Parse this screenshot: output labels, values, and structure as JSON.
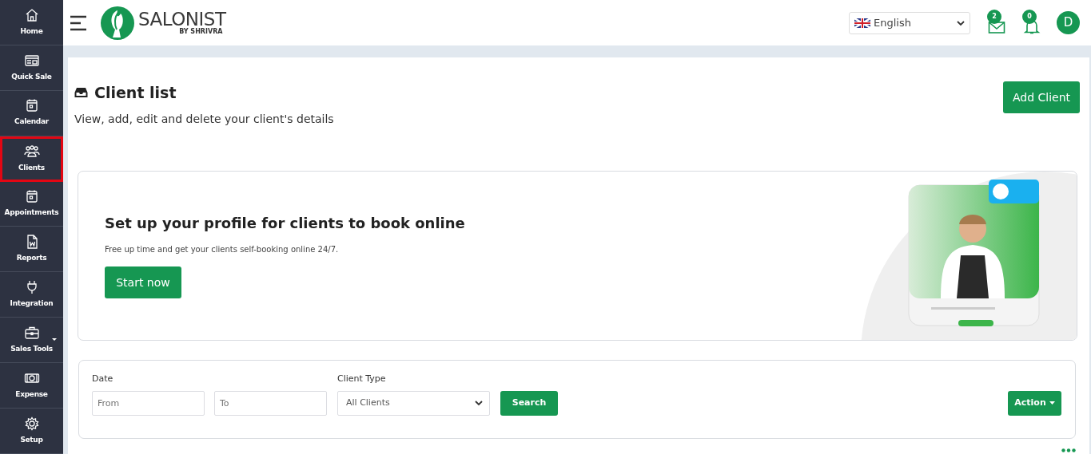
{
  "sidebar": {
    "items": [
      {
        "label": "Home",
        "selected": false,
        "has_submenu": false
      },
      {
        "label": "Quick Sale",
        "selected": false,
        "has_submenu": false
      },
      {
        "label": "Calendar",
        "selected": false,
        "has_submenu": false
      },
      {
        "label": "Clients",
        "selected": true,
        "has_submenu": false
      },
      {
        "label": "Appointments",
        "selected": false,
        "has_submenu": false
      },
      {
        "label": "Reports",
        "selected": false,
        "has_submenu": false
      },
      {
        "label": "Integration",
        "selected": false,
        "has_submenu": false
      },
      {
        "label": "Sales Tools",
        "selected": false,
        "has_submenu": true
      },
      {
        "label": "Expense",
        "selected": false,
        "has_submenu": false
      },
      {
        "label": "Setup",
        "selected": false,
        "has_submenu": false
      }
    ]
  },
  "header": {
    "logo_name": "SALONIST",
    "logo_tagline": "BY SHRIVRA",
    "language": "English",
    "messages_count": "2",
    "notifications_count": "0",
    "avatar_initial": "D"
  },
  "page": {
    "title": "Client list",
    "subtitle": "View, add, edit and delete your client's details",
    "add_button": "Add Client"
  },
  "promo": {
    "title": "Set up your profile for clients to book online",
    "text": "Free up time and get your clients self-booking online 24/7.",
    "button": "Start now"
  },
  "filters": {
    "date_label": "Date",
    "from_placeholder": "From",
    "to_placeholder": "To",
    "client_type_label": "Client Type",
    "client_type_value": "All Clients",
    "search_button": "Search",
    "action_button": "Action"
  }
}
